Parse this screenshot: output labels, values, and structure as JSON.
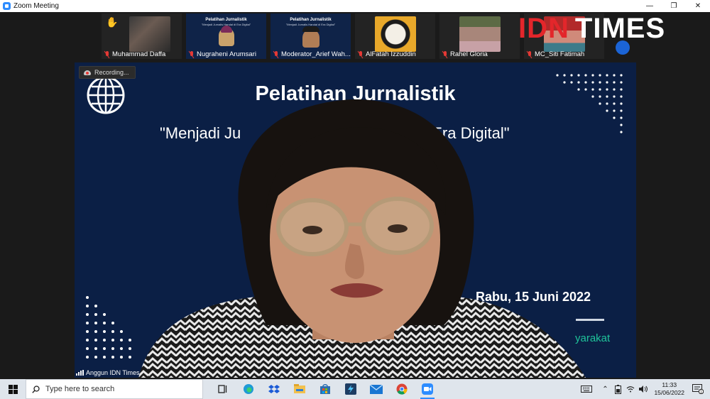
{
  "window": {
    "title": "Zoom Meeting",
    "controls": [
      "—",
      "❐",
      "✕"
    ]
  },
  "gallery": [
    {
      "name": "Muhammad Daffa",
      "muted": true,
      "hand_raised": true
    },
    {
      "name": "Nugraheni Arumsari",
      "muted": true
    },
    {
      "name": "Moderator_Arief Wah...",
      "muted": true
    },
    {
      "name": "AlFatah Izzuddin",
      "muted": true
    },
    {
      "name": "Rahel Gloria",
      "muted": true
    },
    {
      "name": "MC_Siti Fatimah",
      "muted": true
    }
  ],
  "gallery_slide_thumb": {
    "title": "Pelatihan Jurnalistik",
    "subtitle": "\"Menjadi Jurnalis Handal di Era Digital\""
  },
  "watermark": {
    "idn": "IDN",
    "times": "TIMES"
  },
  "main": {
    "recording_label": "Recording...",
    "slide_title": "Pelatihan Jurnalistik",
    "slide_subtitle": "\"Menjadi Ju",
    "slide_subtitle_tail": "di Era Digital\"",
    "slide_date": "Rabu, 15 Juni 2022",
    "slide_org_fragment": "yarakat",
    "speaker_name": "Anggun IDN Times"
  },
  "taskbar": {
    "search_placeholder": "Type here to search",
    "time": "11:33",
    "date": "15/06/2022",
    "apps": [
      "task-view-icon",
      "edge-icon",
      "dropbox-icon",
      "file-explorer-icon",
      "store-icon",
      "terminal-icon",
      "mail-icon",
      "chrome-icon",
      "zoom-icon"
    ]
  },
  "colors": {
    "slide_bg": "#0b1f45",
    "idn_red": "#e3262b",
    "accent_green": "#1fc39a",
    "zoom_blue": "#2d8cff"
  }
}
